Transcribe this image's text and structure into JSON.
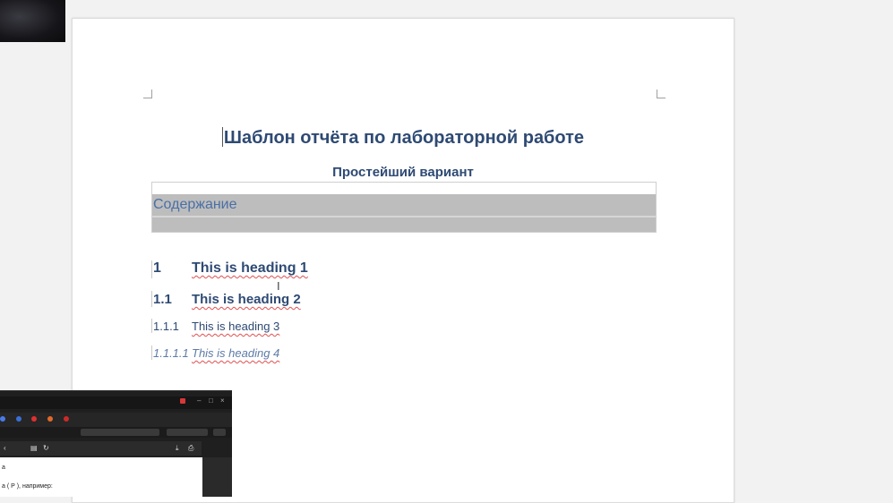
{
  "document": {
    "title": "Шаблон отчёта по лабораторной работе",
    "subtitle": "Простейший вариант",
    "toc_title": "Содержание",
    "headings": [
      {
        "number": "1",
        "text": "This is heading 1"
      },
      {
        "number": "1.1",
        "text": "This is heading 2"
      },
      {
        "number": "1.1.1",
        "text": "This is heading 3"
      },
      {
        "number": "1.1.1.1",
        "text": "This is heading 4"
      }
    ]
  },
  "overlay_browser": {
    "bookmarks": [
      "",
      "",
      "",
      "",
      ""
    ],
    "content_line1": "а",
    "content_line2": "а ( Р ), например:"
  },
  "colors": {
    "heading": "#2e4a73",
    "toc_title": "#4a6fa5",
    "toc_band": "#bdbdbd"
  }
}
